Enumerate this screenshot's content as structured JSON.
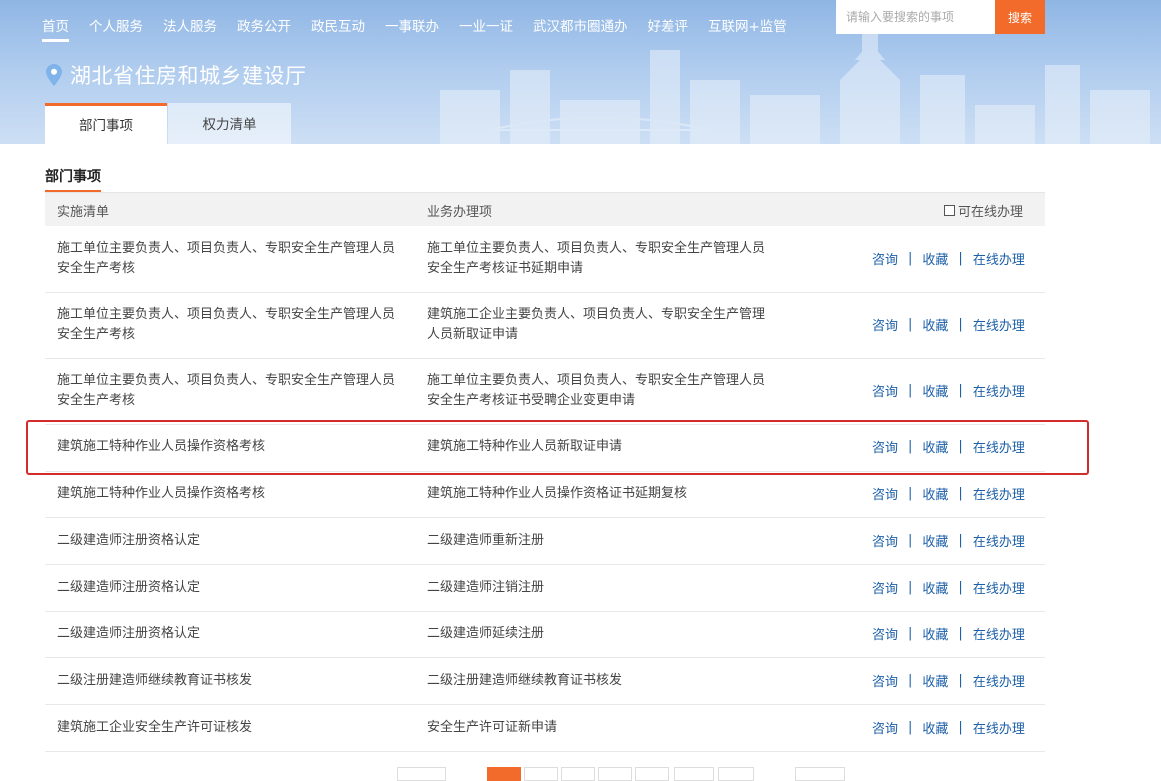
{
  "nav": {
    "items": [
      "首页",
      "个人服务",
      "法人服务",
      "政务公开",
      "政民互动",
      "一事联办",
      "一业一证",
      "武汉都市圈通办",
      "好差评",
      "互联网+监管"
    ],
    "active_index": 0
  },
  "search": {
    "placeholder": "请输入要搜索的事项",
    "button_label": "搜索"
  },
  "department": {
    "title": "湖北省住房和城乡建设厅",
    "icon": "location-pin-icon"
  },
  "tabs": [
    "部门事项",
    "权力清单"
  ],
  "section": {
    "title": "部门事项",
    "columns": [
      "实施清单",
      "业务办理项"
    ],
    "online_filter_label": "可在线办理"
  },
  "actions": {
    "consult": "咨询",
    "favorite": "收藏",
    "online": "在线办理",
    "separator": "|"
  },
  "rows": [
    {
      "list": "施工单位主要负责人、项目负责人、专职安全生产管理人员安全生产考核",
      "item": "施工单位主要负责人、项目负责人、专职安全生产管理人员安全生产考核证书延期申请"
    },
    {
      "list": "施工单位主要负责人、项目负责人、专职安全生产管理人员安全生产考核",
      "item": "建筑施工企业主要负责人、项目负责人、专职安全生产管理人员新取证申请"
    },
    {
      "list": "施工单位主要负责人、项目负责人、专职安全生产管理人员安全生产考核",
      "item": "施工单位主要负责人、项目负责人、专职安全生产管理人员安全生产考核证书受聘企业变更申请"
    },
    {
      "list": "建筑施工特种作业人员操作资格考核",
      "item": "建筑施工特种作业人员新取证申请",
      "highlighted": true
    },
    {
      "list": "建筑施工特种作业人员操作资格考核",
      "item": "建筑施工特种作业人员操作资格证书延期复核"
    },
    {
      "list": "二级建造师注册资格认定",
      "item": "二级建造师重新注册"
    },
    {
      "list": "二级建造师注册资格认定",
      "item": "二级建造师注销注册"
    },
    {
      "list": "二级建造师注册资格认定",
      "item": "二级建造师延续注册"
    },
    {
      "list": "二级注册建造师继续教育证书核发",
      "item": "二级注册建造师继续教育证书核发"
    },
    {
      "list": "建筑施工企业安全生产许可证核发",
      "item": "安全生产许可证新申请"
    }
  ],
  "colors": {
    "accent": "#f26b2a",
    "link": "#1c5fa8",
    "highlight_border": "#d22c2c",
    "banner": "#aecbee"
  }
}
